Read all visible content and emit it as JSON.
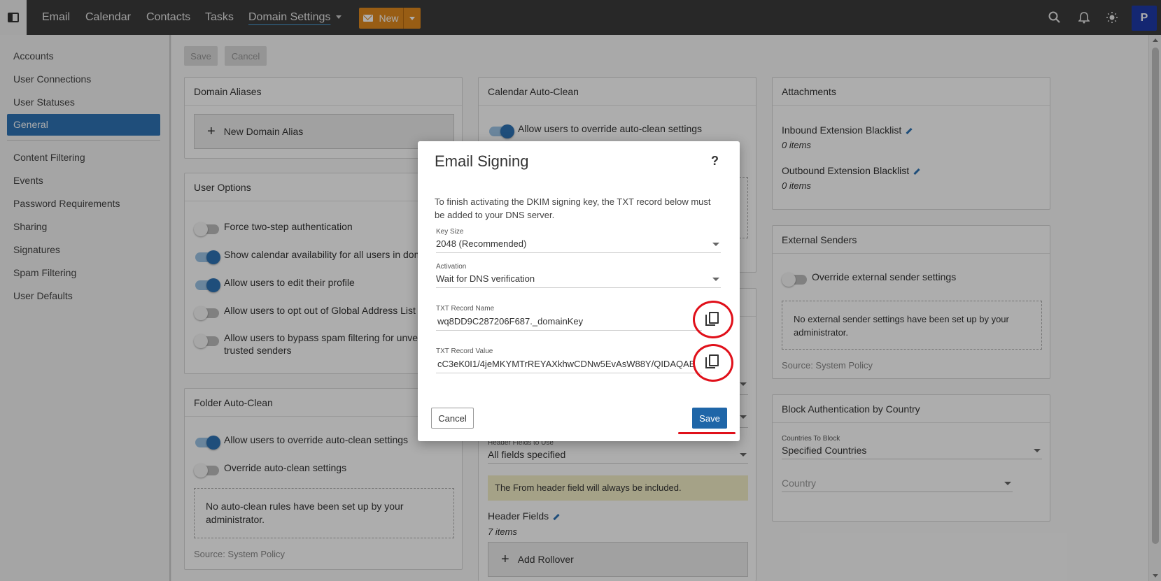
{
  "topbar": {
    "nav": [
      "Email",
      "Calendar",
      "Contacts",
      "Tasks",
      "Domain Settings"
    ],
    "new_label": "New",
    "avatar_initial": "P",
    "icons": [
      "search-icon",
      "bell-icon",
      "sun-icon"
    ]
  },
  "sidebar": {
    "items": [
      "Accounts",
      "User Connections",
      "User Statuses",
      "General",
      "Content Filtering",
      "Events",
      "Password Requirements",
      "Sharing",
      "Signatures",
      "Spam Filtering",
      "User Defaults"
    ],
    "active": "General"
  },
  "toolbar": {
    "save": "Save",
    "cancel": "Cancel"
  },
  "domain_aliases": {
    "title": "Domain Aliases",
    "new_alias": "New Domain Alias"
  },
  "user_options": {
    "title": "User Options",
    "options": [
      {
        "label": "Force two-step authentication",
        "on": false
      },
      {
        "label": "Show calendar availability for all users in doma",
        "on": true
      },
      {
        "label": "Allow users to edit their profile",
        "on": true
      },
      {
        "label": "Allow users to opt out of Global Address List",
        "on": false
      },
      {
        "label": "Allow users to bypass spam filtering for unver",
        "label2": "trusted senders",
        "on": false
      }
    ]
  },
  "folder_autoclean": {
    "title": "Folder Auto-Clean",
    "opt1": "Allow users to override auto-clean settings",
    "opt2": "Override auto-clean settings",
    "empty": "No auto-clean rules have been set up by your administrator.",
    "source": "Source: System Policy"
  },
  "calendar_autoclean": {
    "title": "Calendar Auto-Clean",
    "opt1": "Allow users to override auto-clean settings",
    "header_fields_label": "Header Fields to Use",
    "header_fields_value": "All fields specified",
    "note": "The From header field will always be included.",
    "header_fields": "Header Fields",
    "items": "7 items",
    "add_rollover": "Add Rollover"
  },
  "attachments": {
    "title": "Attachments",
    "inbound": "Inbound Extension Blacklist",
    "inbound_count": "0 items",
    "outbound": "Outbound Extension Blacklist",
    "outbound_count": "0 items"
  },
  "external_senders": {
    "title": "External Senders",
    "opt": "Override external sender settings",
    "empty": "No external sender settings have been set up by your administrator.",
    "source": "Source: System Policy"
  },
  "block_auth": {
    "title": "Block Authentication by Country",
    "countries_label": "Countries To Block",
    "countries_value": "Specified Countries",
    "country_placeholder": "Country"
  },
  "modal": {
    "title": "Email Signing",
    "help": "?",
    "description": "To finish activating the DKIM signing key, the TXT record below must be added to your DNS server.",
    "key_size_label": "Key Size",
    "key_size_value": "2048 (Recommended)",
    "activation_label": "Activation",
    "activation_value": "Wait for DNS verification",
    "txt_name_label": "TXT Record Name",
    "txt_name_value": "wq8DD9C287206F687._domainKey",
    "txt_value_label": "TXT Record Value",
    "txt_value_value": "cC3eK0I1/4jeMKYMTrREYAXkhwCDNw5EvAsW88Y/QIDAQAB",
    "cancel": "Cancel",
    "save": "Save"
  },
  "annotation_color": "#e0101a"
}
